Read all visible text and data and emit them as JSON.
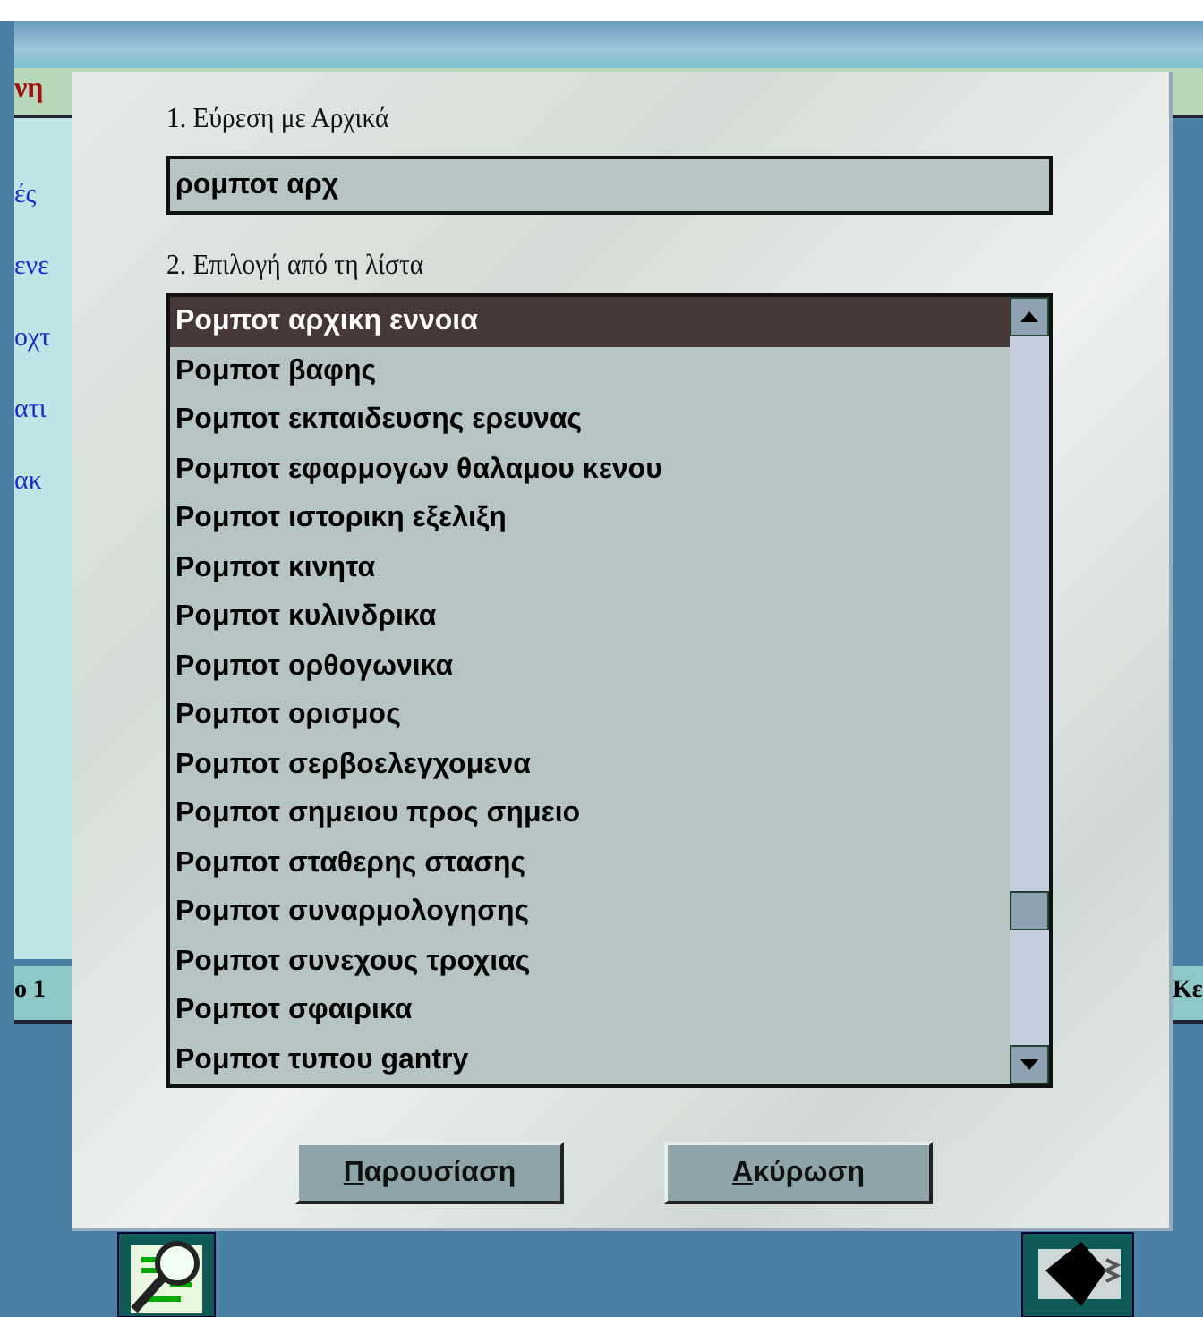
{
  "background": {
    "header_text": "νη",
    "side_texts": [
      "ές",
      "ενε",
      "οχτ",
      "ατι",
      "ακ"
    ],
    "left_tab": "ο 1",
    "right_tab": "Κε"
  },
  "dialog": {
    "search_label": "1. Εύρεση με Αρχικά",
    "search_value": "ρομποτ αρχ",
    "list_label": "2. Επιλογή από τη λίστα",
    "items": [
      {
        "label": "Ρομποτ αρχικη εννοια",
        "selected": true
      },
      {
        "label": "Ρομποτ βαφης",
        "selected": false
      },
      {
        "label": "Ρομποτ εκπαιδευσης ερευνας",
        "selected": false
      },
      {
        "label": "Ρομποτ εφαρμογων θαλαμου κενου",
        "selected": false
      },
      {
        "label": "Ρομποτ ιστορικη εξελιξη",
        "selected": false
      },
      {
        "label": "Ρομποτ κινητα",
        "selected": false
      },
      {
        "label": "Ρομποτ κυλινδρικα",
        "selected": false
      },
      {
        "label": "Ρομποτ ορθογωνικα",
        "selected": false
      },
      {
        "label": "Ρομποτ ορισμος",
        "selected": false
      },
      {
        "label": "Ρομποτ σερβοελεγχομενα",
        "selected": false
      },
      {
        "label": "Ρομποτ σημειου προς σημειο",
        "selected": false
      },
      {
        "label": "Ρομποτ σταθερης στασης",
        "selected": false
      },
      {
        "label": "Ρομποτ συναρμολογησης",
        "selected": false
      },
      {
        "label": "Ρομποτ συνεχους τροχιας",
        "selected": false
      },
      {
        "label": "Ρομποτ σφαιρικα",
        "selected": false
      },
      {
        "label": "Ρομποτ τυπου gantry",
        "selected": false
      }
    ],
    "buttons": [
      {
        "label": "Παρουσίαση",
        "mnemonic_first": true
      },
      {
        "label": "Ακύρωση",
        "mnemonic_first": true
      }
    ]
  }
}
